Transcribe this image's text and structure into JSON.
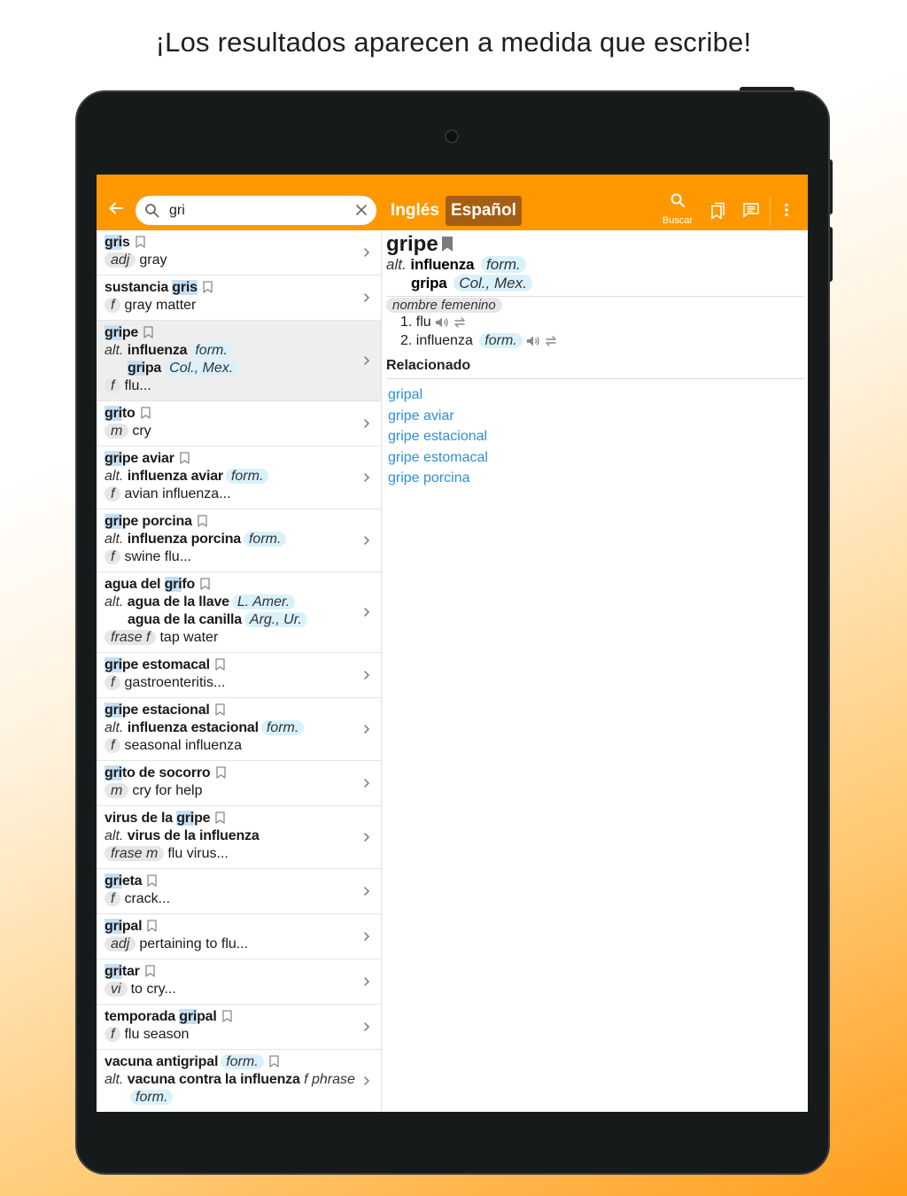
{
  "headline": "¡Los resultados aparecen a medida que escribe!",
  "search": {
    "value": "gri"
  },
  "tabs": {
    "english": "Inglés",
    "spanish": "Español"
  },
  "toolbar": {
    "search_label": "Buscar"
  },
  "results": [
    {
      "lines": [
        {
          "head": [
            [
              "gri",
              true
            ],
            [
              "s",
              false
            ]
          ]
        },
        {
          "tag": "adj",
          "text": "gray"
        }
      ]
    },
    {
      "lines": [
        {
          "head": [
            [
              "sustancia ",
              false
            ],
            [
              "gris",
              true
            ]
          ]
        },
        {
          "tag": "f",
          "text": "gray matter"
        }
      ]
    },
    {
      "selected": true,
      "lines": [
        {
          "head": [
            [
              "gri",
              true
            ],
            [
              "pe",
              false
            ]
          ]
        },
        {
          "alt": "alt.",
          "text": "influenza",
          "reg": "form."
        },
        {
          "indent": true,
          "head": [
            [
              "gri",
              true
            ],
            [
              "pa",
              false
            ]
          ],
          "reg": "Col., Mex."
        },
        {
          "tag": "f",
          "text": "flu..."
        }
      ]
    },
    {
      "lines": [
        {
          "head": [
            [
              "gri",
              true
            ],
            [
              "to",
              false
            ]
          ]
        },
        {
          "tag": "m",
          "text": "cry"
        }
      ]
    },
    {
      "lines": [
        {
          "head": [
            [
              "gri",
              true
            ],
            [
              "pe aviar",
              false
            ]
          ]
        },
        {
          "alt": "alt.",
          "text": "influenza aviar",
          "reg": "form."
        },
        {
          "tag": "f",
          "text": "avian influenza..."
        }
      ]
    },
    {
      "lines": [
        {
          "head": [
            [
              "gri",
              true
            ],
            [
              "pe porcina",
              false
            ]
          ]
        },
        {
          "alt": "alt.",
          "text": "influenza porcina",
          "reg": "form."
        },
        {
          "tag": "f",
          "text": "swine flu..."
        }
      ]
    },
    {
      "lines": [
        {
          "head": [
            [
              "agua del ",
              false
            ],
            [
              "gri",
              true
            ],
            [
              "fo",
              false
            ]
          ]
        },
        {
          "alt": "alt.",
          "text": "agua de la llave",
          "reg": "L. Amer."
        },
        {
          "indent": true,
          "head": [
            [
              "agua de la canilla",
              false
            ]
          ],
          "reg": "Arg., Ur."
        },
        {
          "tag": "frase f",
          "text": "tap water"
        }
      ]
    },
    {
      "lines": [
        {
          "head": [
            [
              "gri",
              true
            ],
            [
              "pe estomacal",
              false
            ]
          ]
        },
        {
          "tag": "f",
          "text": "gastroenteritis..."
        }
      ]
    },
    {
      "lines": [
        {
          "head": [
            [
              "gri",
              true
            ],
            [
              "pe estacional",
              false
            ]
          ]
        },
        {
          "alt": "alt.",
          "text": "influenza estacional",
          "reg": "form."
        },
        {
          "tag": "f",
          "text": "seasonal influenza"
        }
      ]
    },
    {
      "lines": [
        {
          "head": [
            [
              "gri",
              true
            ],
            [
              "to de socorro",
              false
            ]
          ]
        },
        {
          "tag": "m",
          "text": "cry for help"
        }
      ]
    },
    {
      "lines": [
        {
          "head": [
            [
              "virus de la ",
              false
            ],
            [
              "gri",
              true
            ],
            [
              "pe",
              false
            ]
          ]
        },
        {
          "alt": "alt.",
          "text": "virus de la influenza"
        },
        {
          "tag": "frase m",
          "text": "flu virus..."
        }
      ]
    },
    {
      "lines": [
        {
          "head": [
            [
              "gri",
              true
            ],
            [
              "eta",
              false
            ]
          ]
        },
        {
          "tag": "f",
          "text": "crack..."
        }
      ]
    },
    {
      "lines": [
        {
          "head": [
            [
              "gri",
              true
            ],
            [
              "pal",
              false
            ]
          ]
        },
        {
          "tag": "adj",
          "text": "pertaining to flu..."
        }
      ]
    },
    {
      "lines": [
        {
          "head": [
            [
              "gri",
              true
            ],
            [
              "tar",
              false
            ]
          ]
        },
        {
          "tag": "vi",
          "text": "to cry..."
        }
      ]
    },
    {
      "lines": [
        {
          "head": [
            [
              "temporada ",
              false
            ],
            [
              "gri",
              true
            ],
            [
              "pal",
              false
            ]
          ]
        },
        {
          "tag": "f",
          "text": "flu season"
        }
      ]
    },
    {
      "lines": [
        {
          "head": [
            [
              "vacuna antigripal",
              false
            ]
          ],
          "reg": "form."
        },
        {
          "alt": "alt.",
          "text": "vacuna contra la influenza",
          "tail": "f phrase"
        },
        {
          "indent": true,
          "reg": "form."
        }
      ]
    }
  ],
  "detail": {
    "word": "gripe",
    "alt_label": "alt.",
    "alt1": "influenza",
    "alt1_reg": "form.",
    "alt2": "gripa",
    "alt2_reg": "Col., Mex.",
    "pos": "nombre femenino",
    "senses": [
      {
        "text": "1. flu",
        "reg": ""
      },
      {
        "text": "2. influenza",
        "reg": "form."
      }
    ],
    "related_title": "Relacionado",
    "related": [
      "gripal",
      "gripe aviar",
      "gripe estacional",
      "gripe estomacal",
      "gripe porcina"
    ]
  },
  "colors": {
    "accent": "#ff9800",
    "active_tab": "#a65f12",
    "link": "#2f8fda",
    "highlight": "#c4dff6"
  },
  "icons": [
    "back-arrow-icon",
    "search-icon",
    "clear-icon",
    "bookmark-icon",
    "chevron-right-icon",
    "speaker-icon",
    "swap-icon",
    "bookmarks-list-icon",
    "phrasebook-icon",
    "more-vert-icon"
  ]
}
